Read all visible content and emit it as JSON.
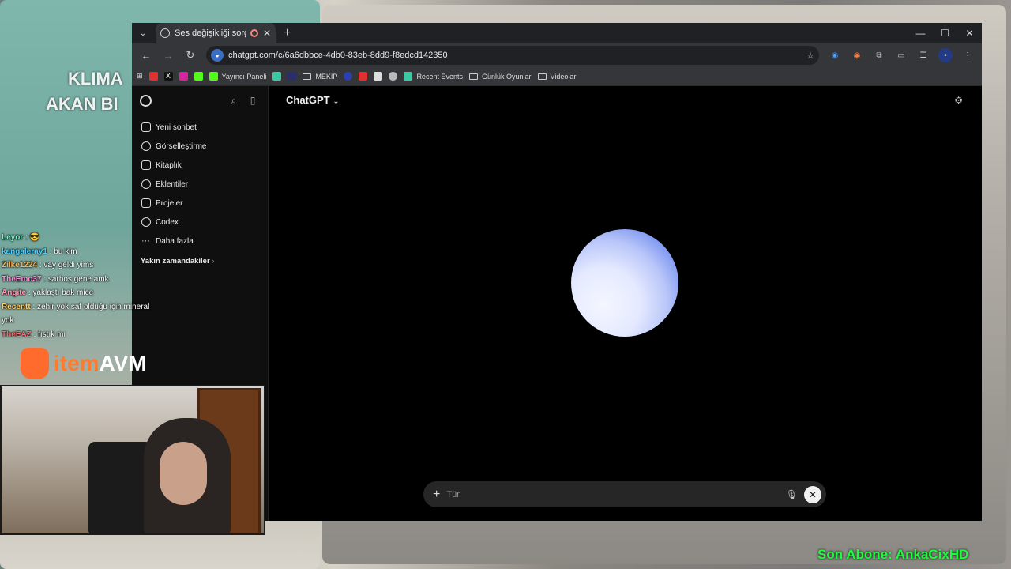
{
  "overlay": {
    "title_lines": [
      "KLIMA",
      "AKAN BI"
    ]
  },
  "browser": {
    "tab_title": "Ses değişikliği sorgulaması",
    "url": "chatgpt.com/c/6a6dbbce-4db0-83eb-8dd9-f8edcd142350",
    "bookmarks": [
      "Yayıncı Paneli",
      "MEKİP",
      "Recent Events",
      "Günlük Oyunlar",
      "Videolar"
    ]
  },
  "sidebar": {
    "items": [
      {
        "label": "Yeni sohbet",
        "icon": "edit-icon"
      },
      {
        "label": "Görselleştirme",
        "icon": "image-icon"
      },
      {
        "label": "Kitaplık",
        "icon": "library-icon"
      },
      {
        "label": "Eklentiler",
        "icon": "plugin-icon"
      },
      {
        "label": "Projeler",
        "icon": "folder-icon"
      },
      {
        "label": "Codex",
        "icon": "codex-icon"
      },
      {
        "label": "Daha fazla",
        "icon": "more-icon"
      }
    ],
    "recent_label": "Yakın zamandakiler"
  },
  "main": {
    "model_label": "ChatGPT",
    "composer_placeholder": "Tür"
  },
  "chat": [
    {
      "user": "Leyor",
      "text": "😎",
      "color": "#7cf0c6"
    },
    {
      "user": "kangaleray1",
      "text": "bu kim",
      "color": "#4fd1ff"
    },
    {
      "user": "Zilke1224",
      "text": "vay geldi yims",
      "color": "#ffb347"
    },
    {
      "user": "TheEmo37",
      "text": "sarhoş gene amk",
      "color": "#ff8ad8"
    },
    {
      "user": "Angite",
      "text": "yaklaştı bak mice",
      "color": "#ff9ab5"
    },
    {
      "user": "Recentt",
      "text": "zehir yok saf olduğu için mineral yok",
      "color": "#ffcf6b"
    },
    {
      "user": "TheEAZ",
      "text": "fıstık mı",
      "color": "#ff6b6b"
    }
  ],
  "brand": {
    "prefix": "item",
    "suffix": "AVM"
  },
  "sub_banner": "Son Abone: AnkaCixHD"
}
